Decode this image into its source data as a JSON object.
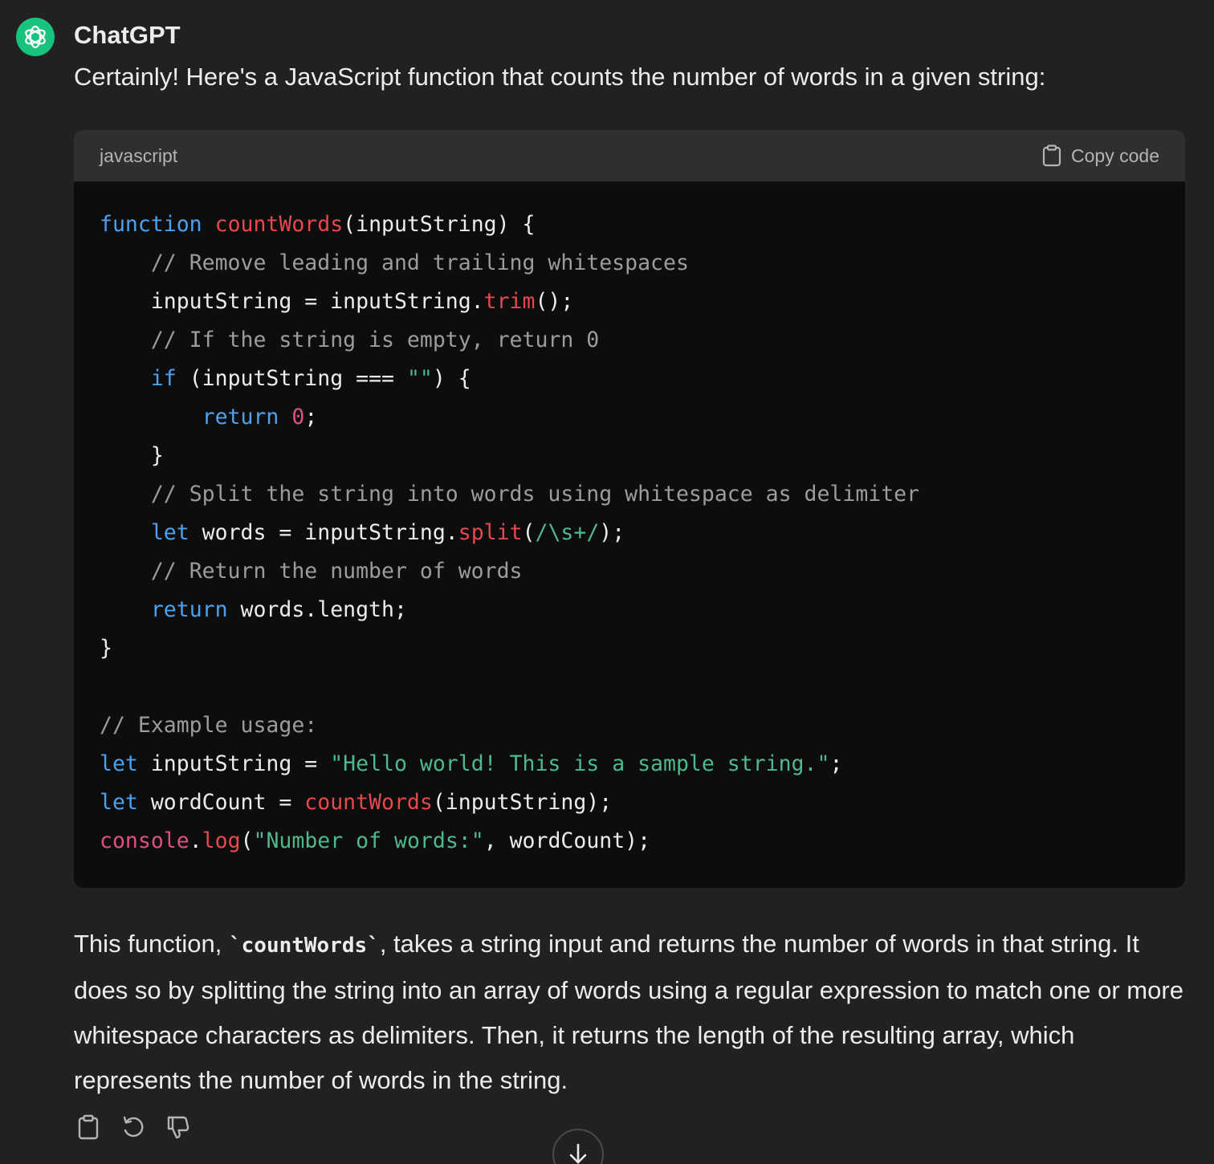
{
  "message": {
    "author": "ChatGPT",
    "intro": "Certainly! Here's a JavaScript function that counts the number of words in a given string:",
    "code_block": {
      "language": "javascript",
      "copy_label": "Copy code",
      "lines": [
        "function countWords(inputString) {",
        "    // Remove leading and trailing whitespaces",
        "    inputString = inputString.trim();",
        "    // If the string is empty, return 0",
        "    if (inputString === \"\") {",
        "        return 0;",
        "    }",
        "    // Split the string into words using whitespace as delimiter",
        "    let words = inputString.split(/\\s+/);",
        "    // Return the number of words",
        "    return words.length;",
        "}",
        "",
        "// Example usage:",
        "let inputString = \"Hello world! This is a sample string.\";",
        "let wordCount = countWords(inputString);",
        "console.log(\"Number of words:\", wordCount);"
      ]
    },
    "explanation": {
      "before": "This function, ",
      "inline_code": "`countWords`",
      "after": ", takes a string input and returns the number of words in that string. It does so by splitting the string into an array of words using a regular expression to match one or more whitespace characters as delimiters. Then, it returns the length of the resulting array, which represents the number of words in the string."
    }
  },
  "actions": [
    {
      "icon": "clipboard-icon"
    },
    {
      "icon": "regenerate-icon"
    },
    {
      "icon": "thumbs-down-icon"
    }
  ],
  "colors": {
    "background": "#212121",
    "code_background": "#0d0d0d",
    "code_header": "#2f2f2f",
    "avatar": "#19c37d",
    "keyword": "#4ea1ef",
    "function": "#e5484d",
    "comment": "#9c9c9c",
    "string": "#4fb88e"
  }
}
